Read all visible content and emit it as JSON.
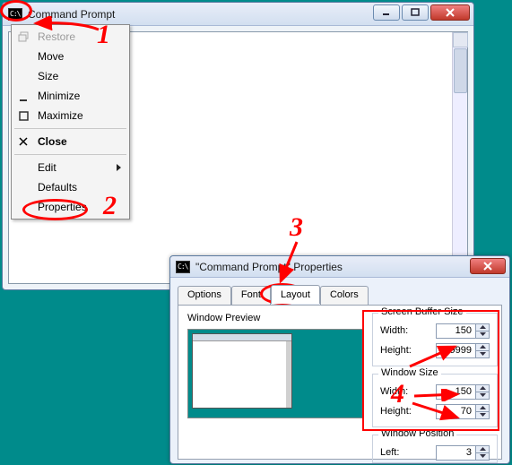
{
  "win1": {
    "title": "Command Prompt",
    "controls": {
      "min_icon": "minimize-icon",
      "max_icon": "maximize-icon",
      "close_icon": "close-icon"
    }
  },
  "sysmenu": {
    "restore": "Restore",
    "move": "Move",
    "size": "Size",
    "minimize": "Minimize",
    "maximize": "Maximize",
    "close": "Close",
    "edit": "Edit",
    "defaults": "Defaults",
    "properties": "Properties"
  },
  "win2": {
    "title": "\"Command Prompt\" Properties",
    "tabs": {
      "options": "Options",
      "font": "Font",
      "layout": "Layout",
      "colors": "Colors"
    },
    "panel": {
      "preview_label": "Window Preview",
      "buffer": {
        "legend": "Screen Buffer Size",
        "width_label": "Width:",
        "width_value": "150",
        "height_label": "Height:",
        "height_value": "9999"
      },
      "winsize": {
        "legend": "Window Size",
        "width_label": "Width:",
        "width_value": "150",
        "height_label": "Height:",
        "height_value": "70"
      },
      "position": {
        "legend": "Window Position",
        "left_label": "Left:",
        "left_value": "3"
      }
    }
  },
  "annotations": {
    "n1": "1",
    "n2": "2",
    "n3": "3",
    "n4": "4"
  }
}
